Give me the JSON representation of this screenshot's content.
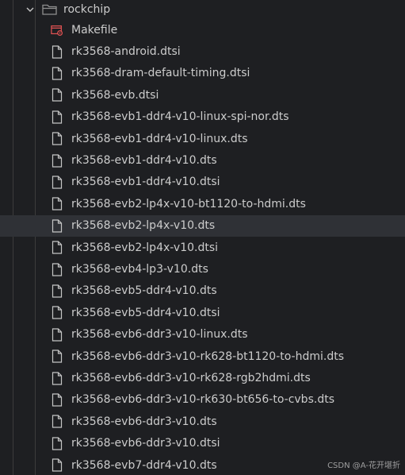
{
  "folder": {
    "name": "rockchip",
    "icon": "folder-open-icon",
    "chevron": "chevron-down-icon"
  },
  "files": [
    {
      "name": "Makefile",
      "icon": "makefile-icon"
    },
    {
      "name": "rk3568-android.dtsi",
      "icon": "file-icon"
    },
    {
      "name": "rk3568-dram-default-timing.dtsi",
      "icon": "file-icon"
    },
    {
      "name": "rk3568-evb.dtsi",
      "icon": "file-icon"
    },
    {
      "name": "rk3568-evb1-ddr4-v10-linux-spi-nor.dts",
      "icon": "file-icon"
    },
    {
      "name": "rk3568-evb1-ddr4-v10-linux.dts",
      "icon": "file-icon"
    },
    {
      "name": "rk3568-evb1-ddr4-v10.dts",
      "icon": "file-icon"
    },
    {
      "name": "rk3568-evb1-ddr4-v10.dtsi",
      "icon": "file-icon"
    },
    {
      "name": "rk3568-evb2-lp4x-v10-bt1120-to-hdmi.dts",
      "icon": "file-icon"
    },
    {
      "name": "rk3568-evb2-lp4x-v10.dts",
      "icon": "file-icon",
      "selected": true
    },
    {
      "name": "rk3568-evb2-lp4x-v10.dtsi",
      "icon": "file-icon"
    },
    {
      "name": "rk3568-evb4-lp3-v10.dts",
      "icon": "file-icon"
    },
    {
      "name": "rk3568-evb5-ddr4-v10.dts",
      "icon": "file-icon"
    },
    {
      "name": "rk3568-evb5-ddr4-v10.dtsi",
      "icon": "file-icon"
    },
    {
      "name": "rk3568-evb6-ddr3-v10-linux.dts",
      "icon": "file-icon"
    },
    {
      "name": "rk3568-evb6-ddr3-v10-rk628-bt1120-to-hdmi.dts",
      "icon": "file-icon"
    },
    {
      "name": "rk3568-evb6-ddr3-v10-rk628-rgb2hdmi.dts",
      "icon": "file-icon"
    },
    {
      "name": "rk3568-evb6-ddr3-v10-rk630-bt656-to-cvbs.dts",
      "icon": "file-icon"
    },
    {
      "name": "rk3568-evb6-ddr3-v10.dts",
      "icon": "file-icon"
    },
    {
      "name": "rk3568-evb6-ddr3-v10.dtsi",
      "icon": "file-icon"
    },
    {
      "name": "rk3568-evb7-ddr4-v10.dts",
      "icon": "file-icon"
    }
  ],
  "watermark": "CSDN @A-花开堪折",
  "colors": {
    "background": "#1e1f22",
    "text": "#cccccc",
    "selected_row": "#2f3136",
    "makefile_accent": "#e05252",
    "folder_icon": "#8f8f8f"
  }
}
